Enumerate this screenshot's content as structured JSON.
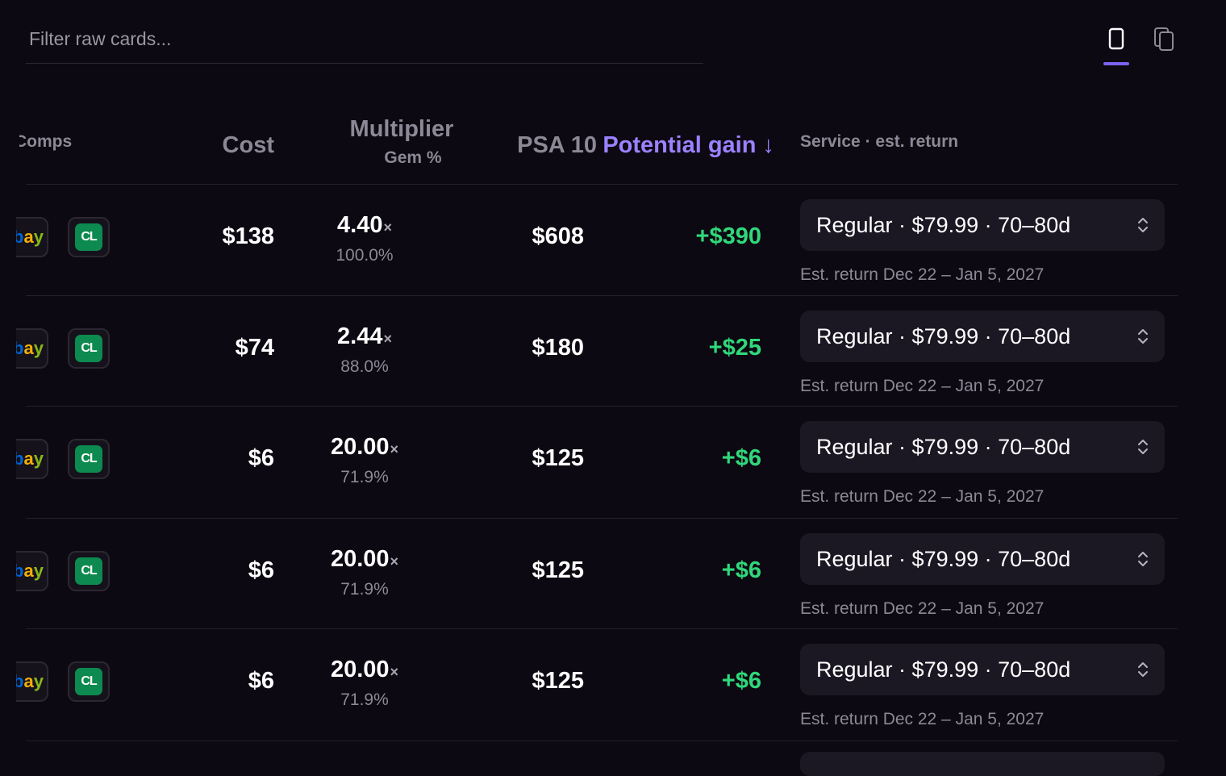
{
  "filter": {
    "placeholder": "Filter raw cards..."
  },
  "view_toggle": {
    "active": "single"
  },
  "headers": {
    "comps": "Comps",
    "cost": "Cost",
    "multiplier": "Multiplier",
    "gem": "Gem %",
    "psa10": "PSA 10",
    "gain": "Potential gain ↓",
    "service": "Service · est. return"
  },
  "rows": [
    {
      "cost": "$138",
      "mult": "4.40",
      "gem": "100.0%",
      "psa": "$608",
      "gain": "+$390",
      "service": "Regular · $79.99 · 70–80d",
      "est": "Est. return Dec 22 – Jan 5, 2027"
    },
    {
      "cost": "$74",
      "mult": "2.44",
      "gem": "88.0%",
      "psa": "$180",
      "gain": "+$25",
      "service": "Regular · $79.99 · 70–80d",
      "est": "Est. return Dec 22 – Jan 5, 2027"
    },
    {
      "cost": "$6",
      "mult": "20.00",
      "gem": "71.9%",
      "psa": "$125",
      "gain": "+$6",
      "service": "Regular · $79.99 · 70–80d",
      "est": "Est. return Dec 22 – Jan 5, 2027"
    },
    {
      "cost": "$6",
      "mult": "20.00",
      "gem": "71.9%",
      "psa": "$125",
      "gain": "+$6",
      "service": "Regular · $79.99 · 70–80d",
      "est": "Est. return Dec 22 – Jan 5, 2027"
    },
    {
      "cost": "$6",
      "mult": "20.00",
      "gem": "71.9%",
      "psa": "$125",
      "gain": "+$6",
      "service": "Regular · $79.99 · 70–80d",
      "est": "Est. return Dec 22 – Jan 5, 2027"
    }
  ],
  "labels": {
    "mult_suffix": "×",
    "ebay": "ebay",
    "cl": "CL"
  },
  "colors": {
    "accent": "#7a63f0",
    "gain": "#2fd87a",
    "muted": "#8c8896"
  }
}
